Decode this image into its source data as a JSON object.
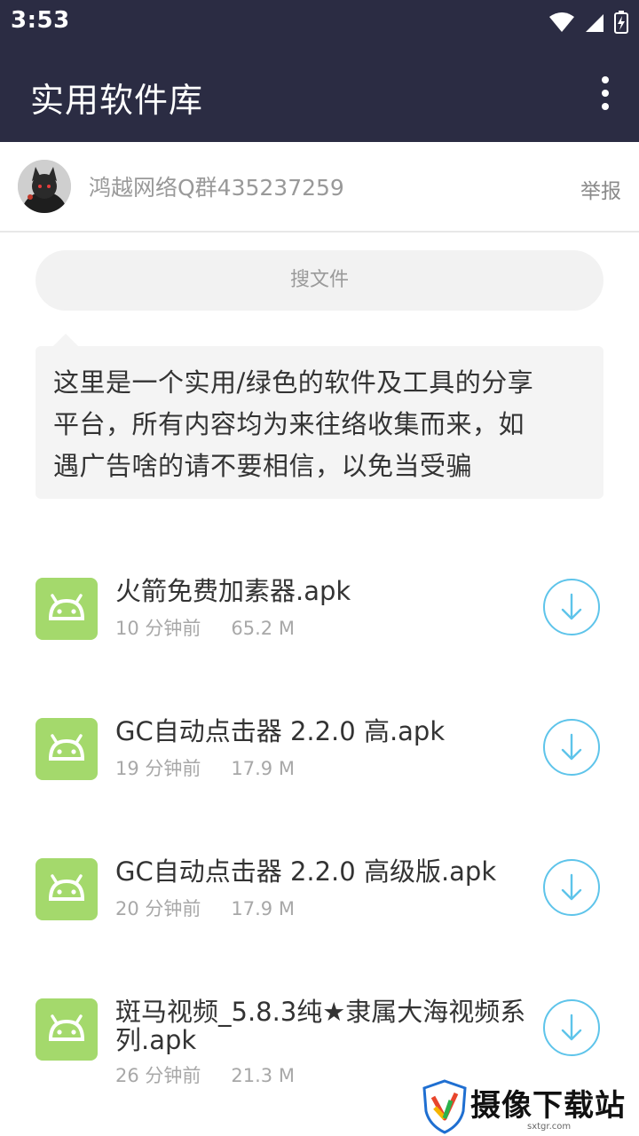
{
  "status_bar": {
    "time": "3:53"
  },
  "app_bar": {
    "title": "实用软件库",
    "menu_icon": "more-vertical-icon"
  },
  "user": {
    "name": "鸿越网络Q群435237259",
    "report_label": "举报"
  },
  "search": {
    "label": "搜文件"
  },
  "description": {
    "line1": "这里是一个实用/绿色的软件及工具的分享",
    "line2": "平台，所有内容均为来往络收集而来，如",
    "line3": "遇广告啥的请不要相信，以免当受骗"
  },
  "files": [
    {
      "name": "火箭免费加素器.apk",
      "time": "10 分钟前",
      "size": "65.2 M",
      "icon": "android-icon"
    },
    {
      "name": "GC自动点击器 2.2.0 高.apk",
      "time": "19 分钟前",
      "size": "17.9 M",
      "icon": "android-icon"
    },
    {
      "name": "GC自动点击器 2.2.0 高级版.apk",
      "time": "20 分钟前",
      "size": "17.9 M",
      "icon": "android-icon"
    },
    {
      "name": "斑马视频_5.8.3纯★隶属大海视频系列.apk",
      "time": "26 分钟前",
      "size": "21.3 M",
      "icon": "android-icon"
    }
  ],
  "watermark": {
    "title": "摄像下载站",
    "url": "sxtgr.com"
  },
  "colors": {
    "app_bar": "#2b2c43",
    "apk_icon": "#a4d96c",
    "download_accent": "#5ec4ea"
  }
}
